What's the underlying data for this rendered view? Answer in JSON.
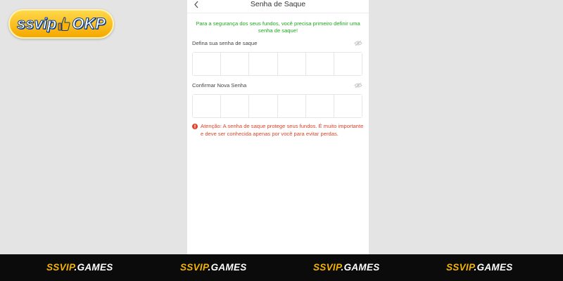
{
  "logo": {
    "text_left": "ssvip",
    "text_right": "OKP"
  },
  "header": {
    "title": "Senha de Saque",
    "back_icon": "chevron-left-icon"
  },
  "notice": "Para a segurança dos seus fundos, você precisa primeiro definir uma senha de saque!",
  "fields": [
    {
      "label": "Defina sua senha de saque",
      "icon": "eye-hidden-icon",
      "digits": 6
    },
    {
      "label": "Confirmar Nova Senha",
      "icon": "eye-hidden-icon",
      "digits": 6
    }
  ],
  "warning": "Atenção: A senha de saque protege seus fundos. É muito importante e deve ser conhecida apenas por você para evitar perdas.",
  "footer": {
    "items": [
      {
        "brand": "SSVIP",
        "tld": ".GAMES"
      },
      {
        "brand": "SSVIP",
        "tld": ".GAMES"
      },
      {
        "brand": "SSVIP",
        "tld": ".GAMES"
      },
      {
        "brand": "SSVIP",
        "tld": ".GAMES"
      }
    ]
  },
  "colors": {
    "notice": "#1faa1f",
    "warning": "#e0432a",
    "logo": "#f5a800",
    "footer_brand": "#f5b400"
  }
}
